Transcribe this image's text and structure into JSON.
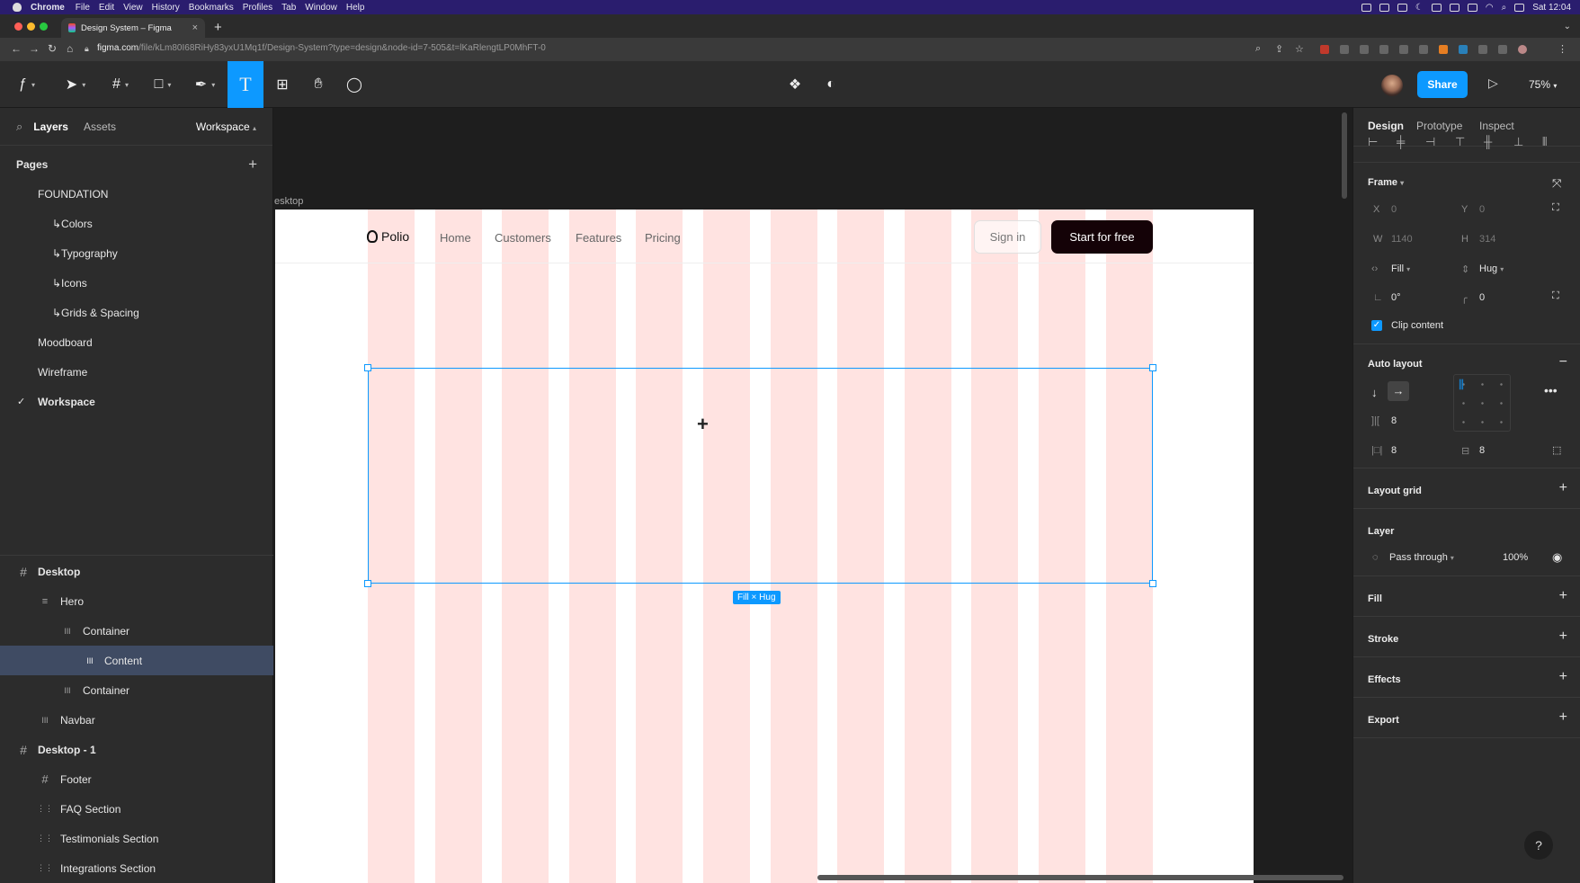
{
  "macbar": {
    "apple": "",
    "menus": [
      "Chrome",
      "File",
      "Edit",
      "View",
      "History",
      "Bookmarks",
      "Profiles",
      "Tab",
      "Window",
      "Help"
    ],
    "clock": "Sat 12:04"
  },
  "browser": {
    "tab_title": "Design System – Figma",
    "tab_close": "×",
    "new_tab": "+",
    "url_domain": "figma.com",
    "url_path": "/file/kLm80I68RiHy83yxU1Mq1f/Design-System?type=design&node-id=7-505&t=lKaRlengtLP0MhFT-0"
  },
  "toolbar": {
    "share_label": "Share",
    "zoom": "75%"
  },
  "left_panel": {
    "tab_layers": "Layers",
    "tab_assets": "Assets",
    "page_switch": "Workspace",
    "pages_header": "Pages",
    "pages": [
      {
        "label": "FOUNDATION",
        "indent": 0
      },
      {
        "label": "↳Colors",
        "indent": 1
      },
      {
        "label": "↳Typography",
        "indent": 1
      },
      {
        "label": "↳Icons",
        "indent": 1
      },
      {
        "label": "↳Grids & Spacing",
        "indent": 1
      },
      {
        "label": "Moodboard",
        "indent": 0
      },
      {
        "label": "Wireframe",
        "indent": 0
      },
      {
        "label": "Workspace",
        "indent": 0
      }
    ],
    "layers": [
      {
        "label": "Desktop",
        "icon": "#",
        "depth": 0
      },
      {
        "label": "Hero",
        "icon": "≡",
        "depth": 1
      },
      {
        "label": "Container",
        "icon": "ǀǀǀ",
        "depth": 2
      },
      {
        "label": "Content",
        "icon": "ǀǀǀ",
        "depth": 3
      },
      {
        "label": "Container",
        "icon": "ǀǀǀ",
        "depth": 2
      },
      {
        "label": "Navbar",
        "icon": "ǀǀǀ",
        "depth": 1
      },
      {
        "label": "Desktop - 1",
        "icon": "#",
        "depth": 0
      },
      {
        "label": "Footer",
        "icon": "#",
        "depth": 1
      },
      {
        "label": "FAQ Section",
        "icon": "⋮⋮",
        "depth": 1
      },
      {
        "label": "Testimonials Section",
        "icon": "⋮⋮",
        "depth": 1
      },
      {
        "label": "Integrations Section",
        "icon": "⋮⋮",
        "depth": 1
      }
    ]
  },
  "canvas": {
    "frame_label": "esktop",
    "logo_text": "Polio",
    "nav_links": [
      "Home",
      "Customers",
      "Features",
      "Pricing"
    ],
    "signin": "Sign in",
    "cta": "Start for free",
    "size_badge": "Fill × Hug",
    "grid_color": "#ffe3e1"
  },
  "right_panel": {
    "tabs": [
      "Design",
      "Prototype",
      "Inspect"
    ],
    "frame_label": "Frame",
    "x_label": "X",
    "x_value": "0",
    "y_label": "Y",
    "y_value": "0",
    "w_label": "W",
    "w_value": "1140",
    "h_label": "H",
    "h_value": "314",
    "w_mode": "Fill",
    "h_mode": "Hug",
    "rotation": "0°",
    "radius": "0",
    "clip_content": "Clip content",
    "autolayout_label": "Auto layout",
    "gap": "8",
    "pad_h": "8",
    "pad_v": "8",
    "layout_grid": "Layout grid",
    "layer_label": "Layer",
    "blend": "Pass through",
    "opacity": "100%",
    "fill": "Fill",
    "stroke": "Stroke",
    "effects": "Effects",
    "export": "Export",
    "help": "?"
  },
  "colors": {
    "accent": "#0d99ff",
    "selected_layer": "#3f4b63",
    "cta_bg": "#140207"
  }
}
